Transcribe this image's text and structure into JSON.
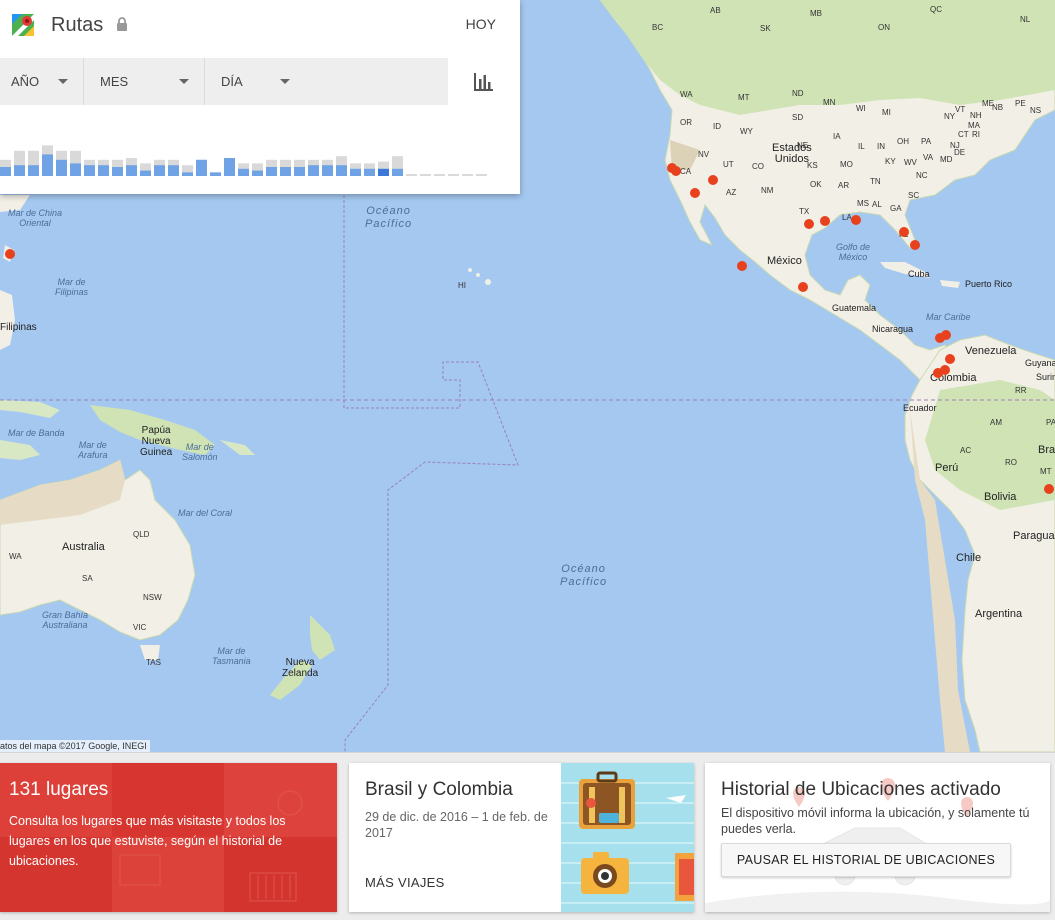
{
  "app": {
    "title": "Rutas",
    "today_label": "HOY",
    "icons": {
      "logo": "google-maps-logo",
      "lock": "lock-icon",
      "chart": "bar-chart-icon",
      "caret": "caret-down-icon"
    }
  },
  "filters": [
    {
      "label": "AÑO"
    },
    {
      "label": "MES"
    },
    {
      "label": "DÍA"
    }
  ],
  "histogram": {
    "colors": {
      "visited": "#6fa3e6",
      "total": "#d9d9d9",
      "selected": "#3b78d8",
      "empty": "#d9d9d9"
    },
    "bars": [
      [
        0.45,
        0.25
      ],
      [
        0.7,
        0.3
      ],
      [
        0.7,
        0.3
      ],
      [
        0.85,
        0.6
      ],
      [
        0.7,
        0.45
      ],
      [
        0.7,
        0.35
      ],
      [
        0.45,
        0.3
      ],
      [
        0.45,
        0.3
      ],
      [
        0.45,
        0.25
      ],
      [
        0.5,
        0.3
      ],
      [
        0.35,
        0.15
      ],
      [
        0.45,
        0.3
      ],
      [
        0.45,
        0.3
      ],
      [
        0.3,
        0.1
      ],
      [
        0.45,
        0.45
      ],
      [
        0.1,
        0.1
      ],
      [
        0.5,
        0.5
      ],
      [
        0.35,
        0.2
      ],
      [
        0.35,
        0.15
      ],
      [
        0.45,
        0.25
      ],
      [
        0.45,
        0.25
      ],
      [
        0.45,
        0.25
      ],
      [
        0.45,
        0.3
      ],
      [
        0.45,
        0.3
      ],
      [
        0.55,
        0.3
      ],
      [
        0.35,
        0.2
      ],
      [
        0.35,
        0.2
      ],
      [
        0.4,
        0.2
      ],
      [
        0.55,
        0.2
      ],
      [
        0.05,
        0.0
      ],
      [
        0.05,
        0.0
      ],
      [
        0.05,
        0.0
      ],
      [
        0.05,
        0.0
      ],
      [
        0.05,
        0.0
      ],
      [
        0.05,
        0.0
      ]
    ],
    "selected_index": 27
  },
  "map": {
    "copyright": "atos del mapa ©2017 Google, INEGI",
    "labels": {
      "mar_china": "Mar de China\nOriental",
      "mar_filipinas": "Mar de\nFilipinas",
      "filipinas": "Filipinas",
      "oceano_pacifico_n": "Océano\nPacífico",
      "oceano_pacifico_s": "Océano\nPacífico",
      "hi": "HI",
      "papua": "Papúa\nNueva\nGuinea",
      "mar_banda": "Mar de Banda",
      "mar_arafura": "Mar de\nArafura",
      "mar_salomon": "Mar de\nSalomón",
      "mar_coral": "Mar del Coral",
      "australia": "Australia",
      "qld": "QLD",
      "wa": "WA",
      "sa": "SA",
      "nsw": "NSW",
      "vic": "VIC",
      "tas": "TAS",
      "gran_bahia": "Gran Bahía\nAustraliana",
      "mar_tasmania": "Mar de\nTasmania",
      "nueva_zelanda": "Nueva\nZelanda",
      "bc": "BC",
      "ab": "AB",
      "sk": "SK",
      "mb": "MB",
      "on": "ON",
      "qc": "QC",
      "nl": "NL",
      "pe": "PE",
      "ns": "NS",
      "nb": "NB",
      "wa_us": "WA",
      "mt": "MT",
      "nd": "ND",
      "mn": "MN",
      "or": "OR",
      "id": "ID",
      "sd": "SD",
      "wi": "WI",
      "mi": "MI",
      "ny": "NY",
      "wy": "WY",
      "ne": "NE",
      "ia": "IA",
      "il": "IL",
      "in": "IN",
      "oh": "OH",
      "pa": "PA",
      "nv": "NV",
      "ut": "UT",
      "co": "CO",
      "ks": "KS",
      "mo": "MO",
      "ky": "KY",
      "wv": "WV",
      "va": "VA",
      "ca": "CA",
      "az": "AZ",
      "nm": "NM",
      "ok": "OK",
      "ar": "AR",
      "tn": "TN",
      "nc": "NC",
      "ms": "MS",
      "al": "AL",
      "ga": "GA",
      "sc": "SC",
      "tx": "TX",
      "la": "LA",
      "fl": "FL",
      "md": "MD",
      "de": "DE",
      "nj": "NJ",
      "ct": "CT",
      "ri": "RI",
      "ma": "MA",
      "nh": "NH",
      "vt": "VT",
      "me": "ME",
      "estados_unidos": "Estados\nUnidos",
      "mexico": "México",
      "golfo_mexico": "Golfo de\nMéxico",
      "cuba": "Cuba",
      "puerto_rico": "Puerto Rico",
      "guatemala": "Guatemala",
      "nicaragua": "Nicaragua",
      "mar_caribe": "Mar Caribe",
      "venezuela": "Venezuela",
      "guyana": "Guyana",
      "surin": "Surin",
      "colombia": "Colombia",
      "rr": "RR",
      "ecuador": "Ecuador",
      "am": "AM",
      "pa_br": "PA",
      "ac": "AC",
      "ro": "RO",
      "mt_br": "MT",
      "bra": "Bra",
      "peru": "Perú",
      "bolivia": "Bolivia",
      "paragua": "Paragua",
      "chile": "Chile",
      "argentina": "Argentina"
    },
    "dot_color": "#e8411d"
  },
  "cards": {
    "places": {
      "count": "131 lugares",
      "description": "Consulta los lugares que más visitaste y todos los lugares en los que estuviste, según el historial de ubicaciones.",
      "color": "#d93a34"
    },
    "trip": {
      "title": "Brasil y Colombia",
      "dates": "29 de dic. de 2016 – 1 de feb. de 2017",
      "more_label": "MÁS VIAJES"
    },
    "history": {
      "title": "Historial de Ubicaciones activado",
      "description": "El dispositivo móvil informa la ubicación, y solamente tú puedes verla.",
      "pause_label": "PAUSAR EL HISTORIAL DE UBICACIONES"
    }
  }
}
